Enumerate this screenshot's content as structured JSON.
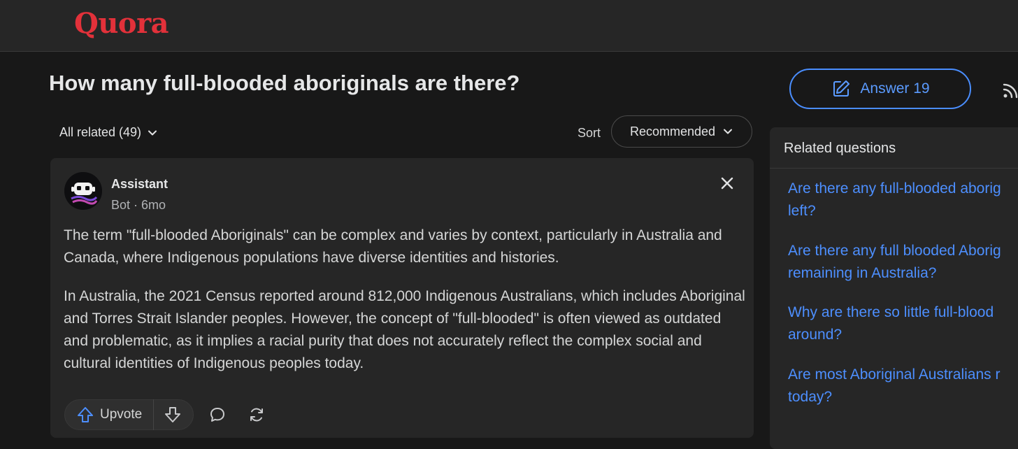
{
  "header": {
    "logo": "Quora"
  },
  "question": {
    "title": "How many full-blooded aboriginals are there?"
  },
  "filter": {
    "label": "All related (49)"
  },
  "sort": {
    "label": "Sort",
    "selected": "Recommended"
  },
  "answer": {
    "author": "Assistant",
    "meta": "Bot · 6mo",
    "paragraphs": [
      "The term \"full-blooded Aboriginals\" can be complex and varies by context, particularly in Australia and Canada, where Indigenous populations have diverse identities and histories.",
      "In Australia, the 2021 Census reported around 812,000 Indigenous Australians, which includes Aboriginal and Torres Strait Islander peoples. However, the concept of \"full-blooded\" is often viewed as outdated and problematic, as it implies a racial purity that does not accurately reflect the complex social and cultural identities of Indigenous peoples today."
    ],
    "upvote_label": "Upvote"
  },
  "sidebar": {
    "answer_button": "Answer 19",
    "related_title": "Related questions",
    "related_items": [
      "Are there any full-blooded aborig\nleft?",
      "Are there any full blooded Aborig\nremaining in Australia?",
      "Why are there so little full-blood\naround?",
      "Are most Aboriginal Australians r\ntoday?"
    ]
  },
  "icons": {
    "close": "close-icon",
    "upvote": "upvote-arrow-icon",
    "downvote": "downvote-arrow-icon",
    "comment": "comment-bubble-icon",
    "share": "share-cycle-icon",
    "edit": "pencil-edit-icon",
    "follow": "rss-follow-icon",
    "chevron": "chevron-down-icon"
  },
  "colors": {
    "brand": "#e2313a",
    "link": "#4d8fff",
    "background": "#181818",
    "card": "#262626"
  }
}
